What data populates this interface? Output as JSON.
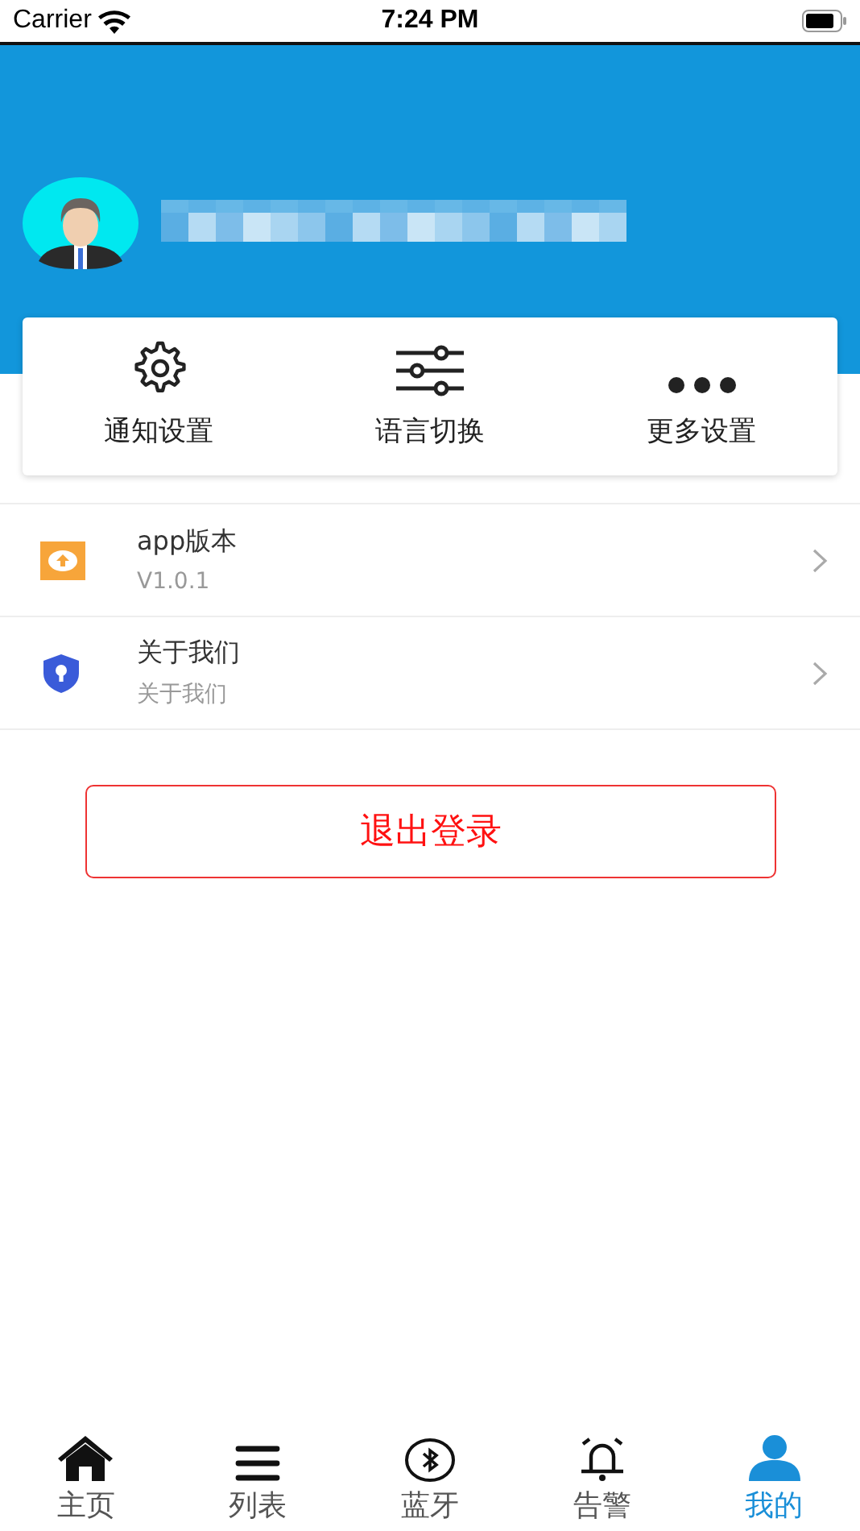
{
  "status_bar": {
    "carrier": "Carrier",
    "time": "7:24 PM"
  },
  "quick_actions": [
    {
      "kind": "gear",
      "label": "通知设置"
    },
    {
      "kind": "sliders",
      "label": "语言切换"
    },
    {
      "kind": "dots",
      "label": "更多设置"
    }
  ],
  "menu": [
    {
      "kind": "upgrade",
      "title": "app版本",
      "subtitle": "V1.0.1"
    },
    {
      "kind": "shield",
      "title": "关于我们",
      "subtitle": "关于我们"
    }
  ],
  "logout_button": "退出登录",
  "tabs": [
    {
      "kind": "home",
      "label": "主页",
      "selected": false
    },
    {
      "kind": "list",
      "label": "列表",
      "selected": false
    },
    {
      "kind": "bluetooth",
      "label": "蓝牙",
      "selected": false
    },
    {
      "kind": "alarm",
      "label": "告警",
      "selected": false
    },
    {
      "kind": "person",
      "label": "我的",
      "selected": true
    }
  ]
}
